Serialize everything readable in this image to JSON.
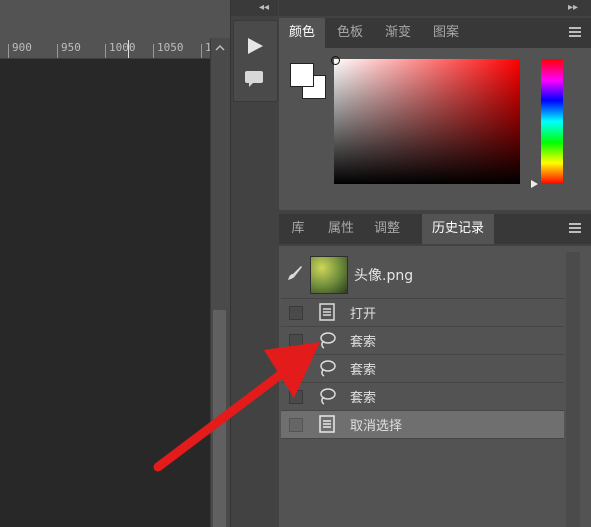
{
  "ruler": {
    "ticks": [
      "900",
      "950",
      "1000",
      "1050",
      "1"
    ]
  },
  "color_panel": {
    "tabs": [
      "颜色",
      "色板",
      "渐变",
      "图案"
    ],
    "active_tab": 0,
    "foreground": "#ffffff",
    "background": "#ffffff",
    "picked_hue": "#ff0000"
  },
  "history_panel": {
    "tabs": [
      "库",
      "属性",
      "调整",
      "历史记录"
    ],
    "active_tab": 3,
    "snapshot": {
      "label": "头像.png"
    },
    "rows": [
      {
        "label": "打开",
        "icon": "document-icon"
      },
      {
        "label": "套索",
        "icon": "lasso-icon"
      },
      {
        "label": "套索",
        "icon": "lasso-icon"
      },
      {
        "label": "套索",
        "icon": "lasso-icon"
      },
      {
        "label": "取消选择",
        "icon": "document-icon"
      }
    ],
    "selected_row": 4
  },
  "annotation": {
    "arrow_color": "#e31b1b"
  }
}
